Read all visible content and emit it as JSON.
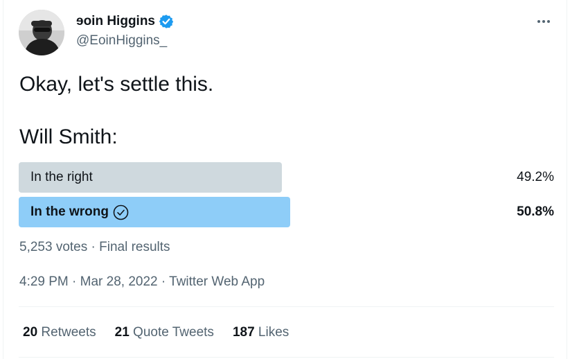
{
  "author": {
    "display_name": "ɘoin Higgins",
    "handle": "@EoinHiggins_",
    "verified": true,
    "avatar_icon": "profile-photo"
  },
  "tweet": {
    "line1": "Okay, let's settle this.",
    "line2": "Will Smith:"
  },
  "poll": {
    "options": [
      {
        "label": "In the right",
        "percent_text": "49.2%",
        "fraction": 0.492,
        "winner": false,
        "bar_color": "#cfd9de"
      },
      {
        "label": "In the wrong",
        "percent_text": "50.8%",
        "fraction": 0.508,
        "winner": true,
        "bar_color": "#8ecdf8"
      }
    ],
    "meta": "5,253 votes · Final results"
  },
  "timestamp": "4:29 PM · Mar 28, 2022 · Twitter Web App",
  "stats": {
    "retweets_count": "20",
    "retweets_label": "Retweets",
    "quotes_count": "21",
    "quotes_label": "Quote Tweets",
    "likes_count": "187",
    "likes_label": "Likes"
  },
  "colors": {
    "verified_badge": "#1d9bf0",
    "secondary_text": "#536471"
  },
  "icons": [
    "verified-badge-icon",
    "more-options-icon",
    "check-circle-icon"
  ]
}
